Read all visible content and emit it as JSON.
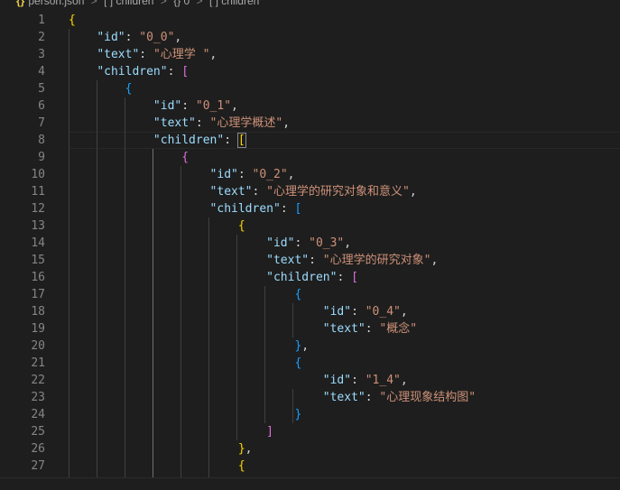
{
  "breadcrumb": {
    "file_icon": "{}",
    "file_name": "person.json",
    "separator": ">",
    "items": [
      {
        "icon": "[ ]",
        "label": "children"
      },
      {
        "icon": "{}",
        "label": "0"
      },
      {
        "icon": "[ ]",
        "label": "children"
      }
    ]
  },
  "editor": {
    "theme_colors": {
      "background": "#1e1e1e",
      "key": "#9cdcfe",
      "string": "#ce9178",
      "bracket_level1": "#ffd700",
      "bracket_level2": "#da70d6",
      "bracket_level3": "#179fff"
    },
    "current_line": 8,
    "lines": [
      {
        "n": "1",
        "tokens": [
          [
            "b1",
            "{"
          ]
        ]
      },
      {
        "n": "2",
        "tokens": [
          [
            "ws",
            "    "
          ],
          [
            "key",
            "\"id\""
          ],
          [
            "p",
            ": "
          ],
          [
            "str",
            "\"0_0\""
          ],
          [
            "p",
            ","
          ]
        ]
      },
      {
        "n": "3",
        "tokens": [
          [
            "ws",
            "    "
          ],
          [
            "key",
            "\"text\""
          ],
          [
            "p",
            ": "
          ],
          [
            "str",
            "\"心理学 \""
          ],
          [
            "p",
            ","
          ]
        ]
      },
      {
        "n": "4",
        "tokens": [
          [
            "ws",
            "    "
          ],
          [
            "key",
            "\"children\""
          ],
          [
            "p",
            ": "
          ],
          [
            "b2",
            "["
          ]
        ]
      },
      {
        "n": "5",
        "tokens": [
          [
            "ws",
            "        "
          ],
          [
            "b3",
            "{"
          ]
        ]
      },
      {
        "n": "6",
        "tokens": [
          [
            "ws",
            "            "
          ],
          [
            "key",
            "\"id\""
          ],
          [
            "p",
            ": "
          ],
          [
            "str",
            "\"0_1\""
          ],
          [
            "p",
            ","
          ]
        ]
      },
      {
        "n": "7",
        "tokens": [
          [
            "ws",
            "            "
          ],
          [
            "key",
            "\"text\""
          ],
          [
            "p",
            ": "
          ],
          [
            "str",
            "\"心理学概述\""
          ],
          [
            "p",
            ","
          ]
        ]
      },
      {
        "n": "8",
        "tokens": [
          [
            "ws",
            "            "
          ],
          [
            "key",
            "\"children\""
          ],
          [
            "p",
            ": "
          ],
          [
            "b1m",
            "["
          ]
        ]
      },
      {
        "n": "9",
        "tokens": [
          [
            "ws",
            "                "
          ],
          [
            "b2",
            "{"
          ]
        ]
      },
      {
        "n": "10",
        "tokens": [
          [
            "ws",
            "                    "
          ],
          [
            "key",
            "\"id\""
          ],
          [
            "p",
            ": "
          ],
          [
            "str",
            "\"0_2\""
          ],
          [
            "p",
            ","
          ]
        ]
      },
      {
        "n": "11",
        "tokens": [
          [
            "ws",
            "                    "
          ],
          [
            "key",
            "\"text\""
          ],
          [
            "p",
            ": "
          ],
          [
            "str",
            "\"心理学的研究对象和意义\""
          ],
          [
            "p",
            ","
          ]
        ]
      },
      {
        "n": "12",
        "tokens": [
          [
            "ws",
            "                    "
          ],
          [
            "key",
            "\"children\""
          ],
          [
            "p",
            ": "
          ],
          [
            "b3",
            "["
          ]
        ]
      },
      {
        "n": "13",
        "tokens": [
          [
            "ws",
            "                        "
          ],
          [
            "b1",
            "{"
          ]
        ]
      },
      {
        "n": "14",
        "tokens": [
          [
            "ws",
            "                            "
          ],
          [
            "key",
            "\"id\""
          ],
          [
            "p",
            ": "
          ],
          [
            "str",
            "\"0_3\""
          ],
          [
            "p",
            ","
          ]
        ]
      },
      {
        "n": "15",
        "tokens": [
          [
            "ws",
            "                            "
          ],
          [
            "key",
            "\"text\""
          ],
          [
            "p",
            ": "
          ],
          [
            "str",
            "\"心理学的研究对象\""
          ],
          [
            "p",
            ","
          ]
        ]
      },
      {
        "n": "16",
        "tokens": [
          [
            "ws",
            "                            "
          ],
          [
            "key",
            "\"children\""
          ],
          [
            "p",
            ": "
          ],
          [
            "b2",
            "["
          ]
        ]
      },
      {
        "n": "17",
        "tokens": [
          [
            "ws",
            "                                "
          ],
          [
            "b3",
            "{"
          ]
        ]
      },
      {
        "n": "18",
        "tokens": [
          [
            "ws",
            "                                    "
          ],
          [
            "key",
            "\"id\""
          ],
          [
            "p",
            ": "
          ],
          [
            "str",
            "\"0_4\""
          ],
          [
            "p",
            ","
          ]
        ]
      },
      {
        "n": "19",
        "tokens": [
          [
            "ws",
            "                                    "
          ],
          [
            "key",
            "\"text\""
          ],
          [
            "p",
            ": "
          ],
          [
            "str",
            "\"概念\""
          ]
        ]
      },
      {
        "n": "20",
        "tokens": [
          [
            "ws",
            "                                "
          ],
          [
            "b3",
            "}"
          ],
          [
            "p",
            ","
          ]
        ]
      },
      {
        "n": "21",
        "tokens": [
          [
            "ws",
            "                                "
          ],
          [
            "b3",
            "{"
          ]
        ]
      },
      {
        "n": "22",
        "tokens": [
          [
            "ws",
            "                                    "
          ],
          [
            "key",
            "\"id\""
          ],
          [
            "p",
            ": "
          ],
          [
            "str",
            "\"1_4\""
          ],
          [
            "p",
            ","
          ]
        ]
      },
      {
        "n": "23",
        "tokens": [
          [
            "ws",
            "                                    "
          ],
          [
            "key",
            "\"text\""
          ],
          [
            "p",
            ": "
          ],
          [
            "str",
            "\"心理现象结构图\""
          ]
        ]
      },
      {
        "n": "24",
        "tokens": [
          [
            "ws",
            "                                "
          ],
          [
            "b3",
            "}"
          ]
        ]
      },
      {
        "n": "25",
        "tokens": [
          [
            "ws",
            "                            "
          ],
          [
            "b2",
            "]"
          ]
        ]
      },
      {
        "n": "26",
        "tokens": [
          [
            "ws",
            "                        "
          ],
          [
            "b1",
            "}"
          ],
          [
            "p",
            ","
          ]
        ]
      },
      {
        "n": "27",
        "tokens": [
          [
            "ws",
            "                        "
          ],
          [
            "b1",
            "{"
          ]
        ]
      }
    ]
  }
}
